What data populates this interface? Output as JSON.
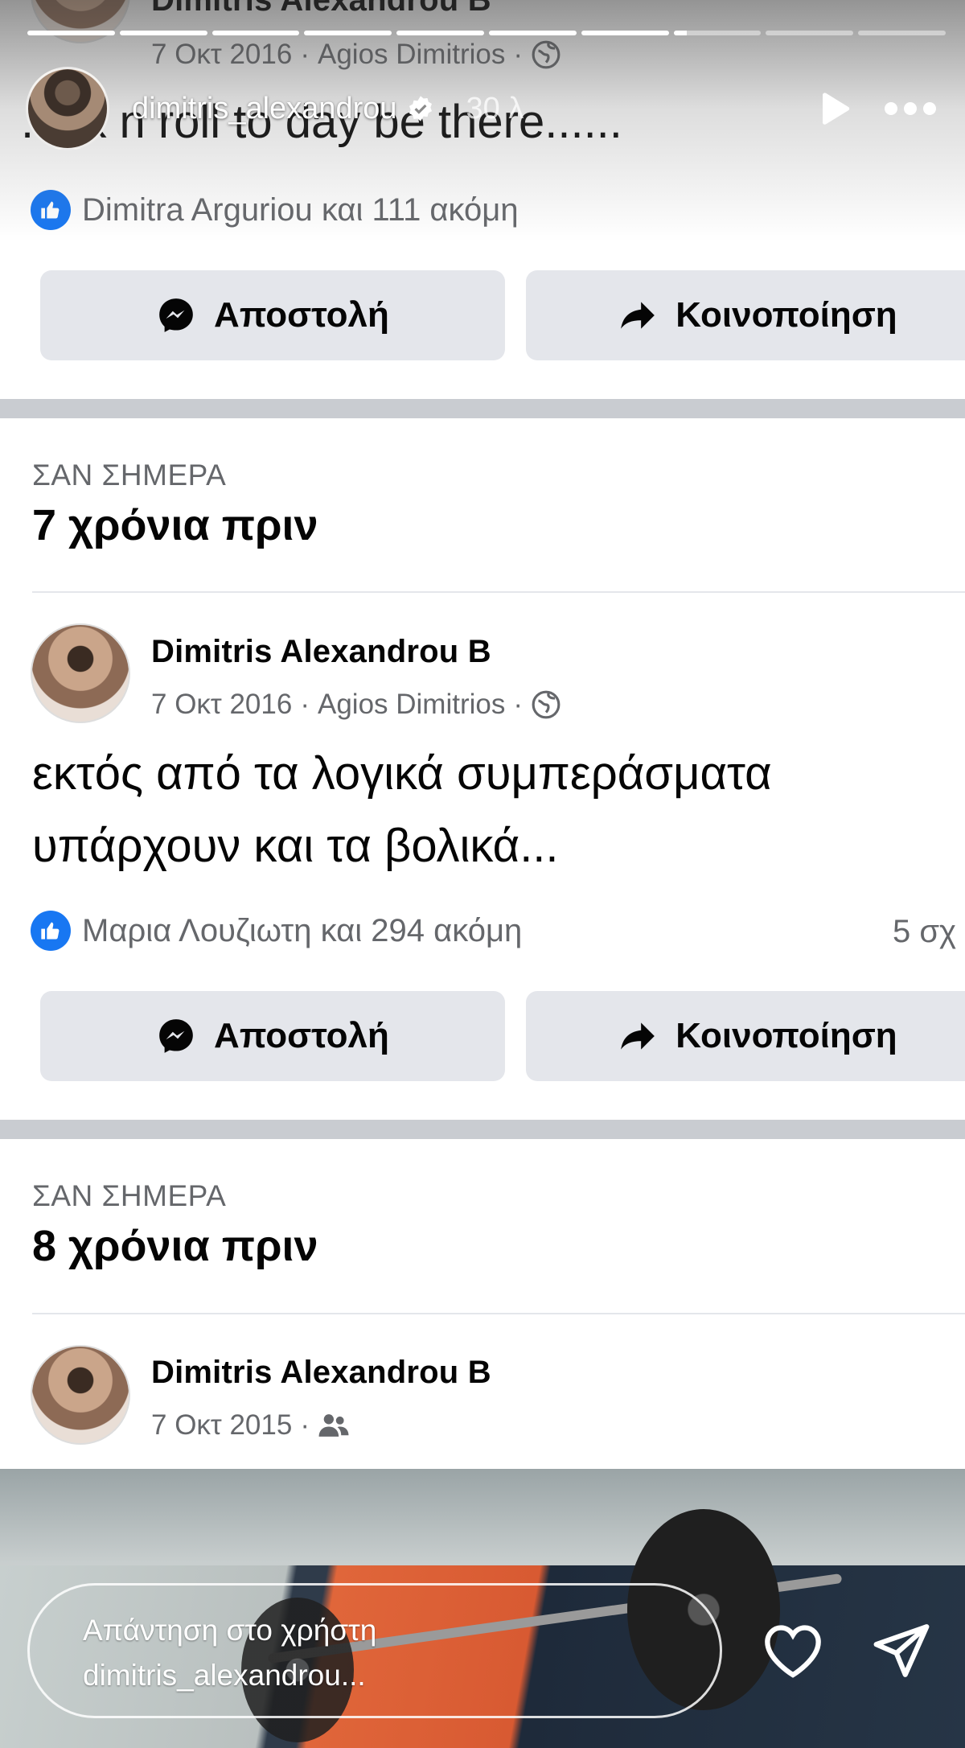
{
  "story": {
    "username": "dimitris_alexandrou",
    "time_ago": "30 λ",
    "progress": [
      1,
      1,
      1,
      1,
      1,
      1,
      1,
      0.15,
      0,
      0
    ],
    "reply_placeholder_line1": "Απάντηση στο χρήστη",
    "reply_placeholder_line2": "dimitris_alexandrou..."
  },
  "ghost_post": {
    "author": "Dimitris Alexandrou B",
    "date": "7 Οκτ 2016",
    "location": "Agios Dimitrios",
    "text": "...ck n roll to day be there......",
    "reactions": "Dimitra Arguriou και 111 ακόμη",
    "send_label": "Αποστολή",
    "share_label": "Κοινοποίηση"
  },
  "memory1": {
    "label": "ΣΑΝ ΣΗΜΕΡΑ",
    "title": "7 χρόνια πριν",
    "author": "Dimitris Alexandrou B",
    "date": "7 Οκτ 2016",
    "location": "Agios Dimitrios",
    "text_line1": "εκτός από τα λογικά συμπεράσματα",
    "text_line2": "υπάρχουν και τα βολικά...",
    "reactions": "Μαρια Λουζιωτη και 294 ακόμη",
    "comments": "5 σχ",
    "send_label": "Αποστολή",
    "share_label": "Κοινοποίηση"
  },
  "memory2": {
    "label": "ΣΑΝ ΣΗΜΕΡΑ",
    "title": "8 χρόνια πριν",
    "author": "Dimitris Alexandrou B",
    "date": "7 Οκτ 2015"
  },
  "icons": {
    "like": "thumbs-up-icon",
    "privacy_public": "globe-icon",
    "privacy_friends": "friends-icon",
    "send": "messenger-icon",
    "share": "share-arrow-icon",
    "heart": "heart-icon",
    "direct": "paper-plane-icon"
  },
  "colors": {
    "facebook_blue": "#1877f2",
    "button_gray": "#e4e6eb",
    "meta_gray": "#65676b",
    "divider": "#c9ccd1"
  }
}
